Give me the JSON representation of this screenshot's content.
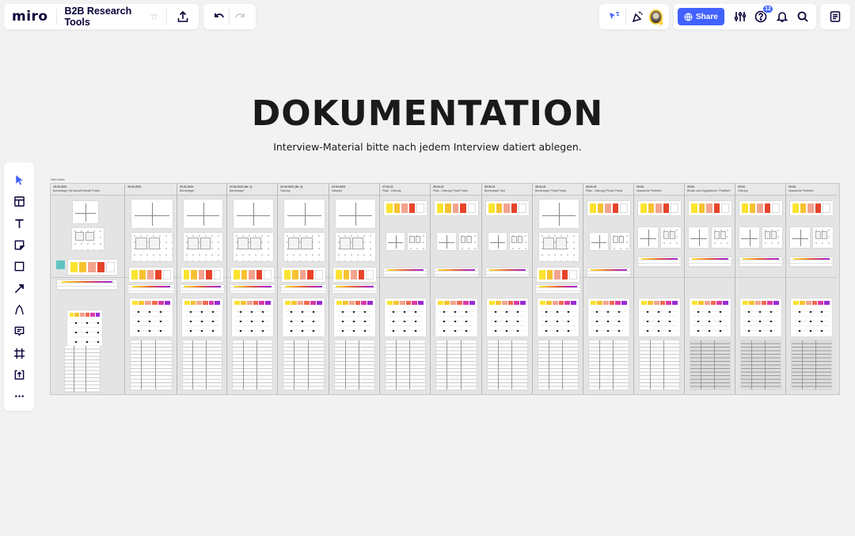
{
  "topbar": {
    "logo": "miro",
    "board_title": "B2B Research Tools",
    "star_icon": "star-icon",
    "export_icon": "upload-icon",
    "undo_icon": "undo-icon",
    "redo_icon": "redo-icon",
    "collab": {
      "reactions_icon": "cursor-flag-icon",
      "celebrate_icon": "party-popper-icon",
      "avatar_icon": "user-avatar"
    },
    "share_label": "Share",
    "settings_icon": "sliders-icon",
    "help_badge": "12",
    "help_icon": "question-icon",
    "notifications_icon": "bell-icon",
    "search_icon": "search-icon",
    "notes_icon": "notes-icon"
  },
  "toolbar": {
    "tools": [
      {
        "name": "select",
        "icon": "cursor-icon",
        "active": true
      },
      {
        "name": "templates",
        "icon": "layout-icon",
        "active": false
      },
      {
        "name": "text",
        "icon": "text-icon",
        "active": false
      },
      {
        "name": "sticky-note",
        "icon": "sticky-note-icon",
        "active": false
      },
      {
        "name": "shape",
        "icon": "square-icon",
        "active": false
      },
      {
        "name": "connection-line",
        "icon": "arrow-icon",
        "active": false
      },
      {
        "name": "pen",
        "icon": "pen-icon",
        "active": false
      },
      {
        "name": "comment",
        "icon": "comment-icon",
        "active": false
      },
      {
        "name": "frame",
        "icon": "frame-icon",
        "active": false
      },
      {
        "name": "upload",
        "icon": "upload-icon",
        "active": false
      },
      {
        "name": "more",
        "icon": "more-icon",
        "active": false
      }
    ]
  },
  "canvas": {
    "heading": "DOKUMENTATION",
    "subheading": "Interview-Material bitte nach jedem Interview datiert ablegen.",
    "board_label": "New table",
    "columns": [
      {
        "date": "15.04.2021",
        "title": "Borntraeger mit Kaeser/Handel Praxis"
      },
      {
        "date": "19.04.2021",
        "title": ""
      },
      {
        "date": "20.04.2021",
        "title": "Borntraeger"
      },
      {
        "date": "22.04.2021 (Nr. 1)",
        "title": "Borntraeger"
      },
      {
        "date": "22.04.2021 (Nr. 2)",
        "title": "Ostrung"
      },
      {
        "date": "23.04.2021",
        "title": "Hasaard"
      },
      {
        "date": "27.04.21",
        "title": "Platz - Ostrung"
      },
      {
        "date": "28.04.21",
        "title": "Platz - Ostrung Privat Praxis"
      },
      {
        "date": "28.04.21",
        "title": "Borntraeger Test"
      },
      {
        "date": "28.04.21",
        "title": "Borntraeger Privat Praxis"
      },
      {
        "date": "28.04.21",
        "title": "Platz - Ostrung (Privat) Praxis"
      },
      {
        "date": "29.04.",
        "title": "Hasadonte Partisten"
      },
      {
        "date": "29.04.",
        "title": "Brüste nach Appelatoren \"Partisten\""
      },
      {
        "date": "29.04.",
        "title": "Ostrung"
      },
      {
        "date": "29.04.",
        "title": "Hasadonte Partisten"
      }
    ]
  }
}
